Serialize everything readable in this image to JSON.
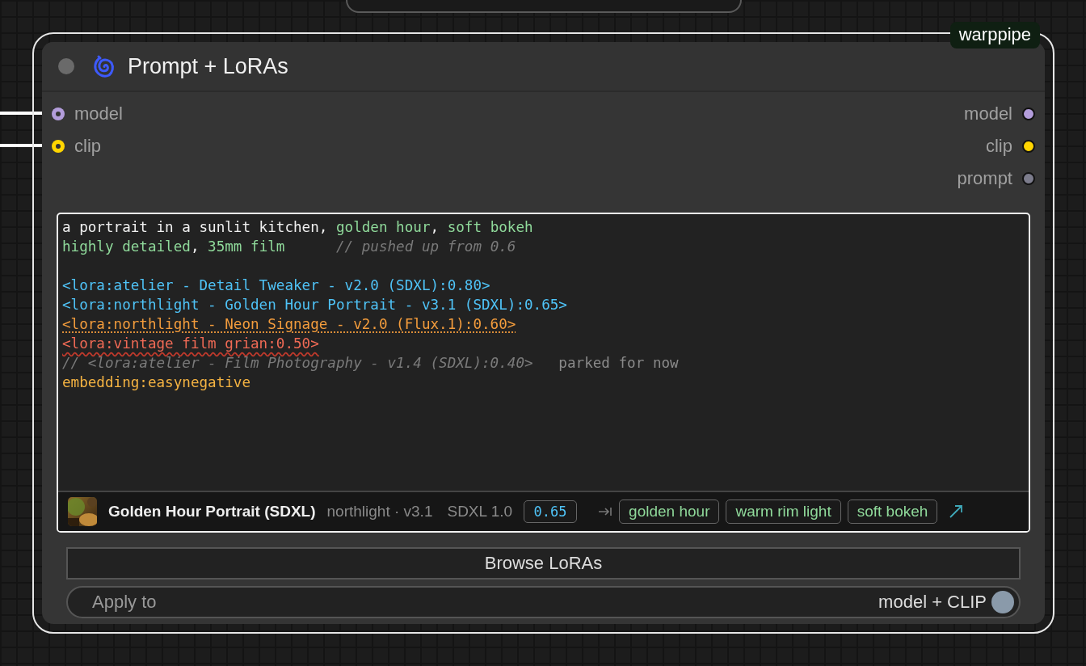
{
  "node": {
    "title": "Prompt + LoRAs",
    "badge": "warppipe",
    "selected": true,
    "inputs": [
      {
        "name": "model",
        "color": "#b39ddb",
        "connected": true
      },
      {
        "name": "clip",
        "color": "#ffd500",
        "connected": true
      }
    ],
    "outputs": [
      {
        "name": "model",
        "color": "#b39ddb"
      },
      {
        "name": "clip",
        "color": "#ffd500"
      },
      {
        "name": "prompt",
        "color": "#7c7c8c"
      }
    ],
    "editor": {
      "lines": [
        {
          "kind": "text",
          "segments": [
            {
              "kind": "plain",
              "text": "a portrait in a sunlit kitchen, "
            },
            {
              "kind": "tag",
              "text": "golden hour"
            },
            {
              "kind": "plain",
              "text": ", "
            },
            {
              "kind": "tag",
              "text": "soft bokeh"
            }
          ]
        },
        {
          "kind": "text",
          "segments": [
            {
              "kind": "tag",
              "text": "highly detailed"
            },
            {
              "kind": "plain",
              "text": ", "
            },
            {
              "kind": "tag",
              "text": "35mm film"
            },
            {
              "kind": "comment",
              "text": "      // pushed up from 0.6"
            }
          ]
        },
        {
          "kind": "blank"
        },
        {
          "kind": "text",
          "segments": [
            {
              "kind": "lora",
              "text": "<lora:atelier - Detail Tweaker - v2.0 (SDXL):0.80>"
            }
          ]
        },
        {
          "kind": "text",
          "segments": [
            {
              "kind": "lora",
              "text": "<lora:northlight - Golden Hour Portrait - v3.1 (SDXL):0.65>"
            }
          ]
        },
        {
          "kind": "text",
          "segments": [
            {
              "kind": "warning",
              "text": "<lora:northlight - Neon Signage - v2.0 (Flux.1):0.60>"
            }
          ]
        },
        {
          "kind": "text",
          "segments": [
            {
              "kind": "error",
              "text": "<lora:vintage film grian:0.50>"
            }
          ]
        },
        {
          "kind": "text",
          "segments": [
            {
              "kind": "comment",
              "text": "// <lora:atelier - Film Photography - v1.4 (SDXL):0.40>"
            },
            {
              "kind": "note",
              "text": "   parked for now"
            }
          ]
        },
        {
          "kind": "text",
          "segments": [
            {
              "kind": "embedding",
              "text": "embedding:easynegative"
            }
          ]
        }
      ],
      "footer": {
        "title": "Golden Hour Portrait (SDXL)",
        "meta": "northlight · v3.1",
        "base": "SDXL 1.0",
        "weight": "0.65",
        "triggers": [
          "golden hour",
          "warm rim light",
          "soft bokeh"
        ]
      }
    },
    "browse_button": "Browse LoRAs",
    "apply_to": {
      "label": "Apply to",
      "value": "model + CLIP",
      "on": true
    }
  }
}
